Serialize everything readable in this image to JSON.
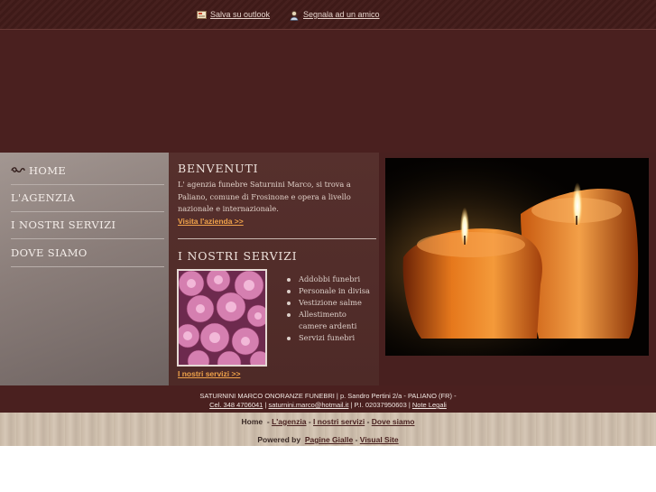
{
  "toolbar": {
    "save_outlook": "Salva su outlook",
    "recommend": "Segnala ad un amico"
  },
  "sidebar": {
    "items": [
      {
        "label": "HOME"
      },
      {
        "label": "L'AGENZIA"
      },
      {
        "label": "I NOSTRI SERVIZI"
      },
      {
        "label": "DOVE SIAMO"
      }
    ]
  },
  "welcome": {
    "title": "BENVENUTI",
    "text": "L' agenzia funebre Saturnini Marco, si trova a Paliano, comune di Frosinone e opera a livello nazionale e internazionale.",
    "link": "Visita l'azienda >>"
  },
  "services": {
    "title": "I NOSTRI SERVIZI",
    "items": [
      "Addobbi funebri",
      "Personale in divisa",
      "Vestizione salme",
      "Allestimento camere ardenti",
      "Servizi funebri"
    ],
    "link": "I nostri servizi >>"
  },
  "footer": {
    "line1": "SATURNINI MARCO ONORANZE FUNEBRI | p. Sandro Pertini 2/a - PALIANO (FR) -",
    "phone": "Cel. 348 4706041",
    "sep1": " | ",
    "email": "saturnini.marco@hotmail.it",
    "vat": " | P.I. 02037950603 | ",
    "legal": "Note Legali"
  },
  "bottom_nav": {
    "home": "Home",
    "agency": "L'agenzia",
    "services": "I nostri servizi",
    "where": "Dove siamo",
    "powered_by": "Powered by",
    "pagine": "Pagine Gialle",
    "dash": "-",
    "visual": "Visual Site"
  },
  "colors": {
    "brand_dark": "#4a201f",
    "link_orange": "#f0a24a"
  }
}
